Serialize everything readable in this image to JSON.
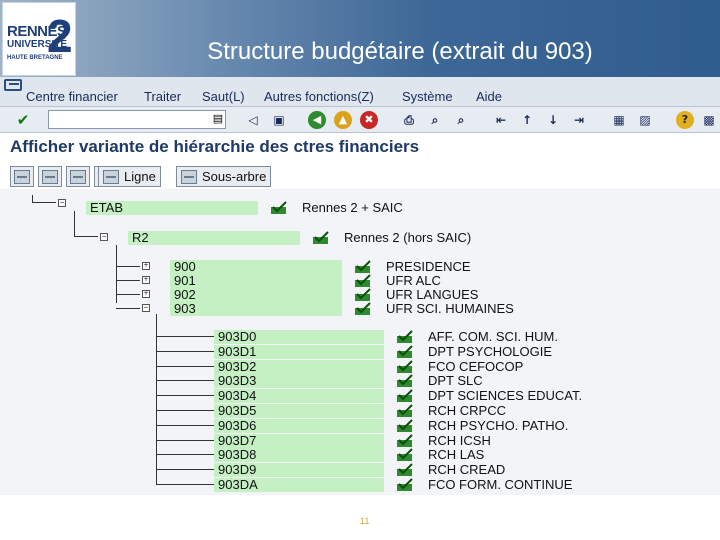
{
  "slide": {
    "logo_line1": "RENNES",
    "logo_line2": "UNIVERSITÉ",
    "logo_line3": "HAUTE BRETAGNE",
    "logo_number": "2",
    "title": "Structure budgétaire (extrait du 903)",
    "page_number": "11"
  },
  "menu": {
    "items": [
      "Centre financier",
      "Traiter",
      "Saut(L)",
      "Autres fonctions(Z)",
      "Système",
      "Aide"
    ]
  },
  "screen": {
    "title": "Afficher variante de hiérarchie des ctres financiers",
    "buttons": {
      "line": "Ligne",
      "subtree": "Sous-arbre"
    }
  },
  "tree": {
    "root": {
      "code": "ETAB",
      "desc": "Rennes 2 + SAIC"
    },
    "level1": {
      "code": "R2",
      "desc": "Rennes 2 (hors SAIC)"
    },
    "level2": [
      {
        "code": "900",
        "desc": "PRESIDENCE"
      },
      {
        "code": "901",
        "desc": "UFR ALC"
      },
      {
        "code": "902",
        "desc": "UFR LANGUES"
      },
      {
        "code": "903",
        "desc": "UFR SCI. HUMAINES"
      }
    ],
    "level3": [
      {
        "code": "903D0",
        "desc": "AFF. COM. SCI. HUM."
      },
      {
        "code": "903D1",
        "desc": "DPT PSYCHOLOGIE"
      },
      {
        "code": "903D2",
        "desc": "FCO CEFOCOP"
      },
      {
        "code": "903D3",
        "desc": "DPT SLC"
      },
      {
        "code": "903D4",
        "desc": "DPT SCIENCES EDUCAT."
      },
      {
        "code": "903D5",
        "desc": "RCH CRPCC"
      },
      {
        "code": "903D6",
        "desc": "RCH PSYCHO. PATHO."
      },
      {
        "code": "903D7",
        "desc": "RCH ICSH"
      },
      {
        "code": "903D8",
        "desc": "RCH LAS"
      },
      {
        "code": "903D9",
        "desc": "RCH CREAD"
      },
      {
        "code": "903DA",
        "desc": "FCO FORM. CONTINUE"
      }
    ]
  }
}
